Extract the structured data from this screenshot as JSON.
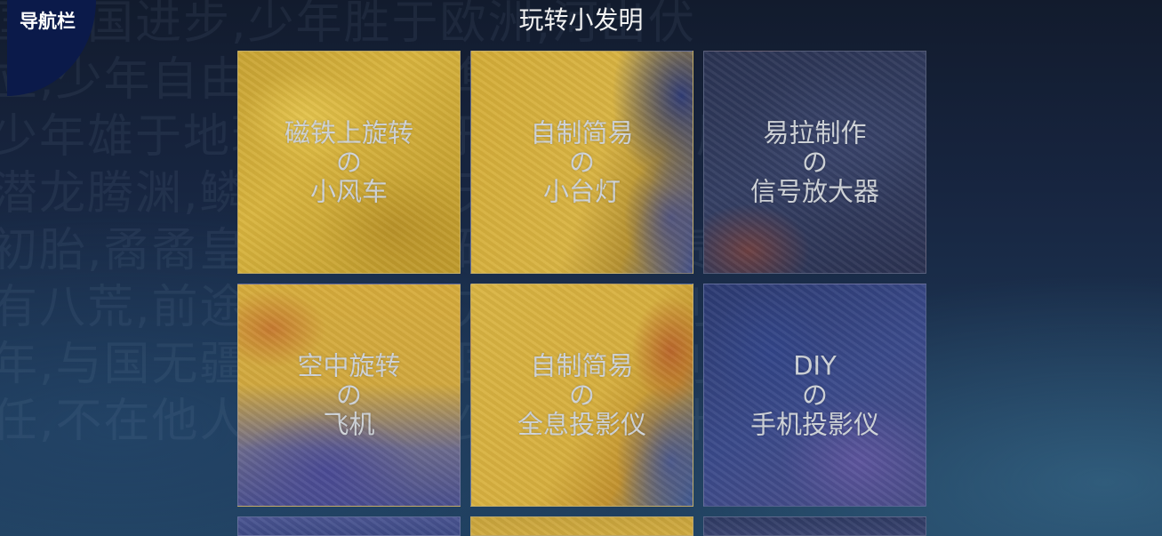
{
  "nav": {
    "label": "导航栏"
  },
  "page": {
    "title": "玩转小发明"
  },
  "background_text": [
    "国则国进步,少年胜于欧洲,河出伏",
    "立,少年自由则国自由,隼试翼,风",
    "少年雄于地球,则国雄于地球苍,地履其黄",
    "潜龙腾渊,鳞爪飞扬,与天不老,",
    "初胎,矞矞皇皇,干将发硎,少年之责任也",
    "有八荒,前途似海,来日方长,年富则国富",
    "年,与国无疆,少年强则国强,进步则国进",
    "任,不在他人,而全在我少年,日初升"
  ],
  "tiles": [
    {
      "line1": "磁铁上旋转",
      "line2": "の",
      "line3": "小风车"
    },
    {
      "line1": "自制简易",
      "line2": "の",
      "line3": "小台灯"
    },
    {
      "line1": "易拉制作",
      "line2": "の",
      "line3": "信号放大器"
    },
    {
      "line1": "空中旋转",
      "line2": "の",
      "line3": "飞机"
    },
    {
      "line1": "自制简易",
      "line2": "の",
      "line3": "全息投影仪"
    },
    {
      "line1": "DIY",
      "line2": "の",
      "line3": "手机投影仪"
    }
  ],
  "colors": {
    "text": "#cfd3d8",
    "nav_bg": "#0b1a4a",
    "title": "#f2f2f2"
  }
}
